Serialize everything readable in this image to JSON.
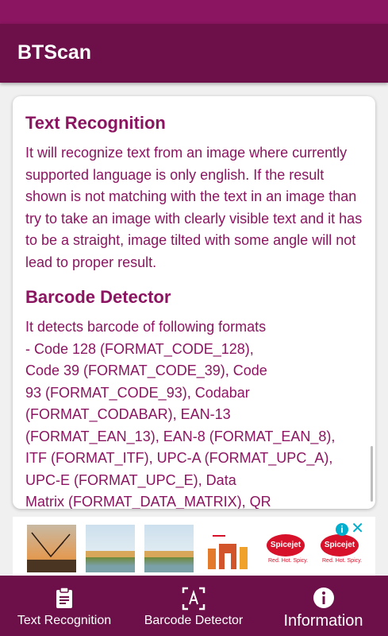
{
  "app": {
    "title": "BTScan"
  },
  "content": {
    "sections": [
      {
        "title": "Text Recognition",
        "body": "It will recognize text from an image where currently supported language is only english. If the result shown is not matching with the text in an image than try to take an image with clearly visible text and it has to be a straight, image tilted with some angle will not lead to proper result."
      },
      {
        "title": "Barcode Detector",
        "body": "It detects barcode of following formats\n- Code 128 (FORMAT_CODE_128),\nCode 39 (FORMAT_CODE_39), Code\n93 (FORMAT_CODE_93), Codabar\n(FORMAT_CODABAR), EAN-13\n(FORMAT_EAN_13), EAN-8 (FORMAT_EAN_8),\nITF (FORMAT_ITF), UPC-A (FORMAT_UPC_A),\nUPC-E (FORMAT_UPC_E), Data\nMatrix (FORMAT_DATA_MATRIX), QR"
      }
    ]
  },
  "ad": {
    "adchoices_icon": "info-icon",
    "close_icon": "close-icon",
    "brand_text": "Spicejet",
    "tagline": "Red. Hot. Spicy."
  },
  "navigation": {
    "items": [
      {
        "label": "Text Recognition",
        "icon": "clipboard-icon",
        "active": false
      },
      {
        "label": "Barcode Detector",
        "icon": "barcode-scan-icon",
        "active": false
      },
      {
        "label": "Information",
        "icon": "info-icon",
        "active": true
      }
    ]
  },
  "colors": {
    "status_bar": "#8b1560",
    "app_bar": "#6d1049",
    "accent_text": "#8b1560",
    "nav_bar": "#6d1049"
  }
}
